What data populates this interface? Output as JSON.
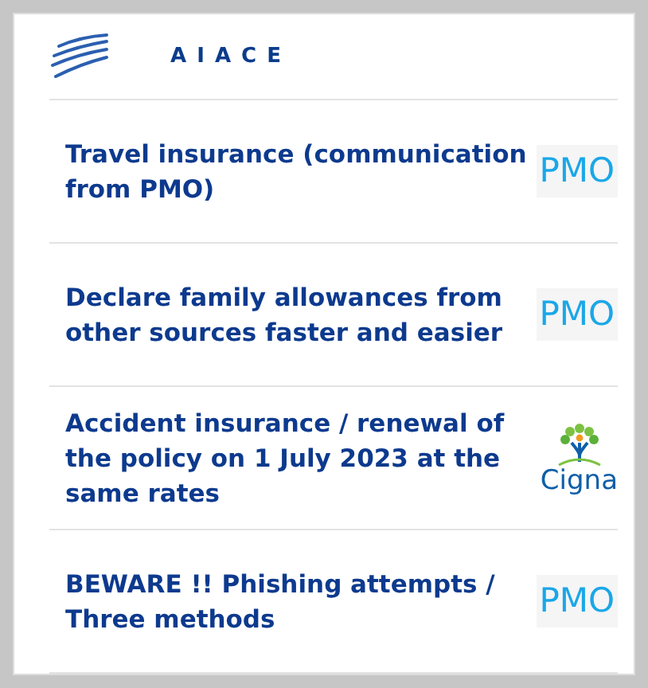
{
  "header": {
    "brand": "A I A C E"
  },
  "articles": [
    {
      "title": "Travel insurance (communication from PMO)",
      "source": {
        "kind": "text-logo",
        "text": "PMO"
      }
    },
    {
      "title": "Declare family allowances from other sources faster and easier",
      "source": {
        "kind": "text-logo",
        "text": "PMO"
      }
    },
    {
      "title": "Accident insurance / renewal of the policy on 1 July 2023 at the same rates",
      "source": {
        "kind": "tree-logo",
        "text": "Cigna"
      }
    },
    {
      "title": "BEWARE !! Phishing attempts / Three methods",
      "source": {
        "kind": "text-logo",
        "text": "PMO"
      }
    }
  ]
}
